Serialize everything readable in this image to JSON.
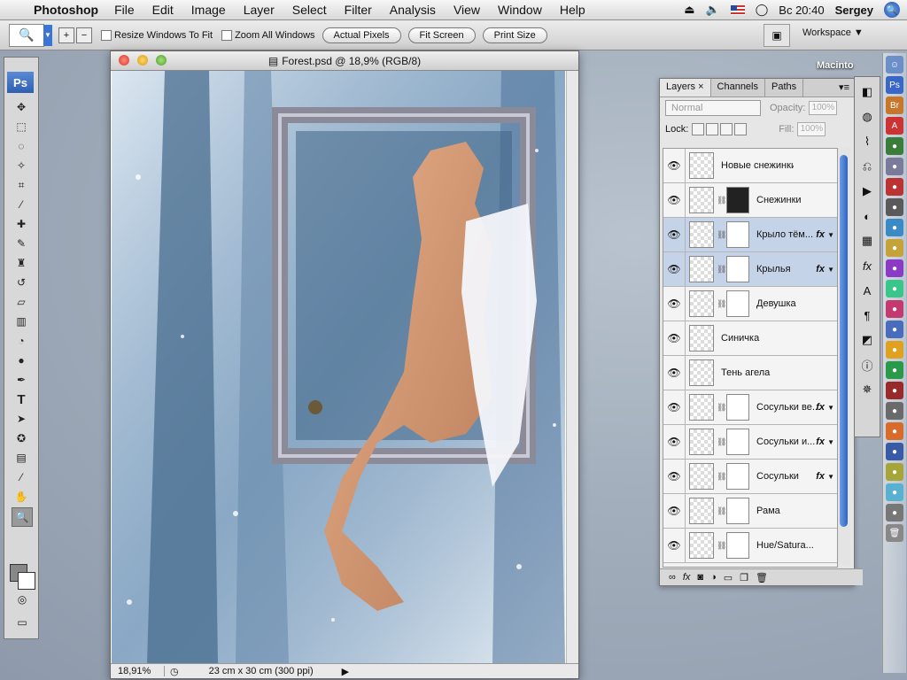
{
  "menubar": {
    "app": "Photoshop",
    "items": [
      "File",
      "Edit",
      "Image",
      "Layer",
      "Select",
      "Filter",
      "Analysis",
      "View",
      "Window",
      "Help"
    ],
    "clock": "Вс 20:40",
    "user": "Sergey"
  },
  "options": {
    "resize_label": "Resize Windows To Fit",
    "zoom_all_label": "Zoom All Windows",
    "actual_pixels": "Actual Pixels",
    "fit_screen": "Fit Screen",
    "print_size": "Print Size",
    "workspace": "Workspace ▼"
  },
  "tools": {
    "logo": "Ps"
  },
  "document": {
    "title": "Forest.psd @ 18,9% (RGB/8)",
    "zoom": "18,91%",
    "doc_info": "23 cm x 30 cm (300 ppi)"
  },
  "desktop": {
    "drive_label": "Macinto"
  },
  "layers_panel": {
    "tabs": [
      "Layers",
      "Channels",
      "Paths"
    ],
    "blend_mode": "Normal",
    "opacity_label": "Opacity:",
    "opacity_value": "100%",
    "lock_label": "Lock:",
    "fill_label": "Fill:",
    "fill_value": "100%",
    "fx_label": "fx",
    "bottom_icons": [
      "link-icon",
      "fx-icon",
      "mask-icon",
      "adjustment-icon",
      "folder-icon",
      "new-layer-icon",
      "trash-icon"
    ],
    "layers": [
      {
        "name": "Новые снежинки",
        "mask": false,
        "fx": false,
        "selected": false
      },
      {
        "name": "Снежинки",
        "mask": true,
        "fx": false,
        "selected": false
      },
      {
        "name": "Крыло тём...",
        "mask": true,
        "fx": true,
        "selected": true
      },
      {
        "name": "Крылья",
        "mask": true,
        "fx": true,
        "selected": true
      },
      {
        "name": "Девушка",
        "mask": true,
        "fx": false,
        "selected": false
      },
      {
        "name": "Синичка",
        "mask": false,
        "fx": false,
        "selected": false
      },
      {
        "name": "Тень агела",
        "mask": false,
        "fx": false,
        "selected": false
      },
      {
        "name": "Сосульки ве...",
        "mask": true,
        "fx": true,
        "selected": false
      },
      {
        "name": "Сосульки и...",
        "mask": true,
        "fx": true,
        "selected": false
      },
      {
        "name": "Сосульки",
        "mask": true,
        "fx": true,
        "selected": false
      },
      {
        "name": "Рама",
        "mask": true,
        "fx": false,
        "selected": false
      },
      {
        "name": "Hue/Satura...",
        "mask": true,
        "fx": false,
        "selected": false
      }
    ]
  }
}
